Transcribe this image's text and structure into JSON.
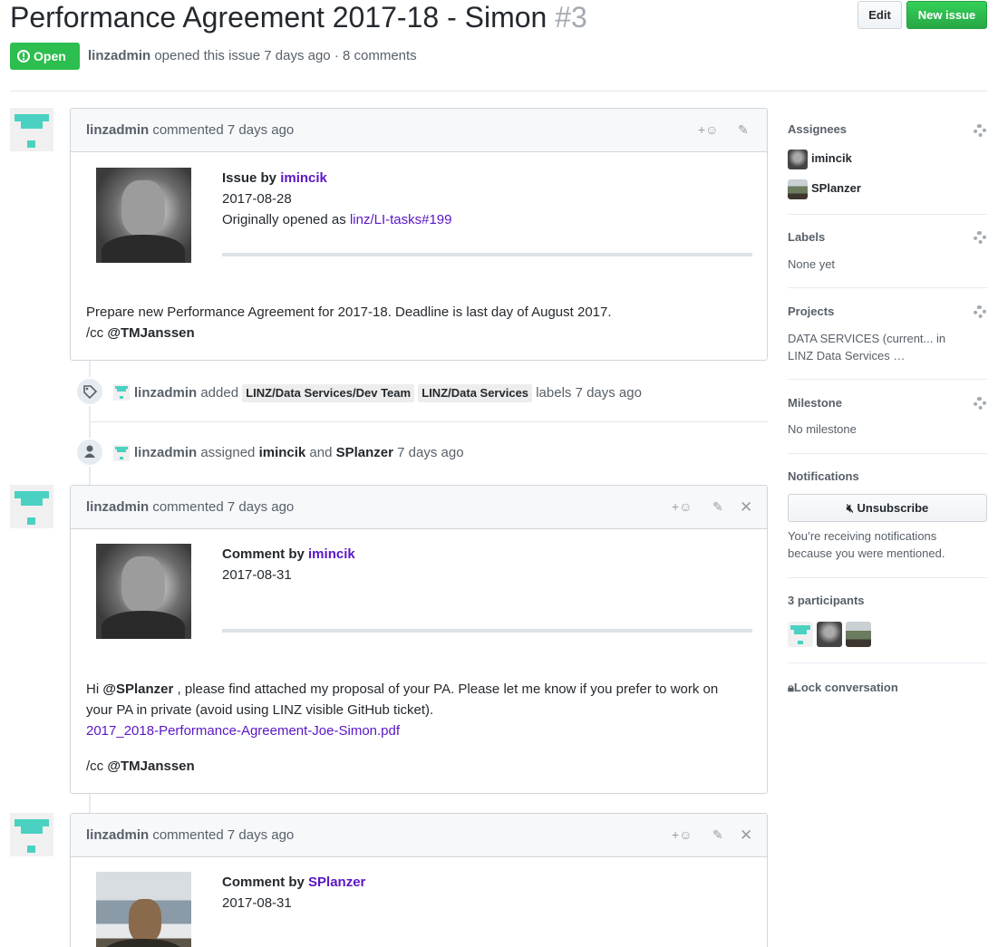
{
  "issue": {
    "title": "Performance Agreement 2017-18 - Simon",
    "number": "#3",
    "edit_label": "Edit",
    "new_issue_label": "New issue",
    "state": "Open",
    "author": "linzadmin",
    "meta_text": "opened this issue 7 days ago · 8 comments"
  },
  "comments": [
    {
      "author": "linzadmin",
      "when": "commented 7 days ago",
      "heading_prefix": "Issue by",
      "heading_user": "imincik",
      "date": "2017-08-28",
      "orig_prefix": "Originally opened as",
      "orig_link": "linz/LI-tasks#199",
      "body_line1": "Prepare new Performance Agreement for 2017-18. Deadline is last day of August 2017.",
      "cc_prefix": "/cc",
      "cc_user": "@TMJanssen"
    },
    {
      "author": "linzadmin",
      "when": "commented 7 days ago",
      "heading_prefix": "Comment by",
      "heading_user": "imincik",
      "date": "2017-08-31",
      "body_hi": "Hi",
      "body_mention": "@SPlanzer",
      "body_rest": ", please find attached my proposal of your PA. Please let me know if you prefer to work on your PA in private (avoid using LINZ visible GitHub ticket).",
      "attachment": "2017_2018-Performance-Agreement-Joe-Simon.pdf",
      "cc_prefix": "/cc",
      "cc_user": "@TMJanssen"
    },
    {
      "author": "linzadmin",
      "when": "commented 7 days ago",
      "heading_prefix": "Comment by",
      "heading_user": "SPlanzer",
      "date": "2017-08-31"
    }
  ],
  "events": {
    "labels": {
      "actor": "linzadmin",
      "verb": "added",
      "label1": "LINZ/Data Services/Dev Team",
      "label2": "LINZ/Data Services",
      "suffix": "labels 7 days ago"
    },
    "assign": {
      "actor": "linzadmin",
      "verb": "assigned",
      "user1": "imincik",
      "and": "and",
      "user2": "SPlanzer",
      "suffix": "7 days ago"
    }
  },
  "sidebar": {
    "assignees_title": "Assignees",
    "assignees": [
      "imincik",
      "SPlanzer"
    ],
    "labels_title": "Labels",
    "labels_value": "None yet",
    "projects_title": "Projects",
    "projects_value": "DATA SERVICES (current... in LINZ Data Services …",
    "milestone_title": "Milestone",
    "milestone_value": "No milestone",
    "notifications_title": "Notifications",
    "unsubscribe_label": "Unsubscribe",
    "notifications_reason": "You’re receiving notifications because you were mentioned.",
    "participants_title": "3 participants",
    "lock_label": "Lock conversation"
  },
  "colors": {
    "open_green": "#2cbe4e",
    "link_purple": "#5a16c5",
    "identicon": "#4bd1c1"
  }
}
